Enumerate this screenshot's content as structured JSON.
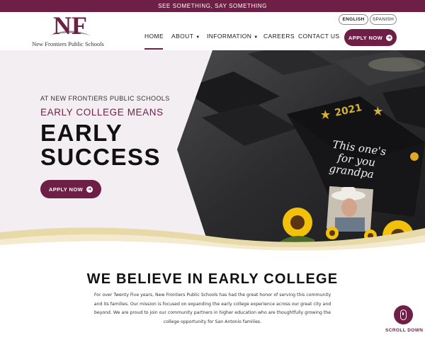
{
  "topbar": {
    "text": "SEE SOMETHING, SAY SOMETHING"
  },
  "logo": {
    "monogram": "NF",
    "name": "New Frontiers Public Schools"
  },
  "language": {
    "english": "ENGLISH",
    "spanish": "SPANISH"
  },
  "nav": {
    "home": "HOME",
    "about": "ABOUT",
    "information": "INFORMATION",
    "careers": "CAREERS",
    "contact": "CONTACT US",
    "caret": "▼",
    "active": "home"
  },
  "header_cta": {
    "label": "APPLY NOW",
    "arrow": "➜"
  },
  "hero": {
    "eyebrow": "AT NEW FRONTIERS PUBLIC SCHOOLS",
    "subtitle": "EARLY COLLEGE MEANS",
    "title_line1": "EARLY",
    "title_line2": "SUCCESS",
    "cta": {
      "label": "APPLY NOW",
      "arrow": "➜"
    },
    "image": {
      "cap_year": "2021",
      "cap_line1": "This one's",
      "cap_line2": "for you",
      "cap_line3": "grandpa"
    }
  },
  "belief": {
    "title": "WE BELIEVE IN EARLY COLLEGE",
    "line1": "For over Twenty Five years, New Frontiers Public Schools has had the great honor of serving this community",
    "line2": "and its families. Our mission is focused on expanding the early college experience across our great city and",
    "line3": "beyond. We are proud to join our community partners in higher education who are thoughtfully growing the",
    "line4": "college opportunity for San Antonio families."
  },
  "scroll": {
    "label": "SCROLL DOWN"
  },
  "colors": {
    "brand": "#6e1f45",
    "cream": "#e8d9a8",
    "hero_bg": "#f3eef1"
  },
  "icons": [
    "arrow-right-circle-icon",
    "mouse-icon",
    "chevron-down-icon",
    "sunflower-icon",
    "star-icon"
  ]
}
